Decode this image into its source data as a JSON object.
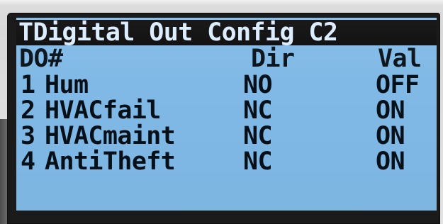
{
  "screen": {
    "title": "TDigital Out Config C2",
    "headers": {
      "id": "DO#",
      "dir": "Dir",
      "val": "Val"
    },
    "rows": [
      {
        "id": "1",
        "name": "Hum",
        "dir": "NO",
        "val": "OFF"
      },
      {
        "id": "2",
        "name": "HVACfail",
        "dir": "NC",
        "val": "ON"
      },
      {
        "id": "3",
        "name": "HVACmaint",
        "dir": "NC",
        "val": "ON"
      },
      {
        "id": "4",
        "name": "AntiTheft",
        "dir": "NC",
        "val": "ON"
      }
    ]
  },
  "colors": {
    "screen_background": "#80b9e6",
    "title_background": "#070707",
    "title_text": "#d9ecff",
    "text": "#061018"
  }
}
